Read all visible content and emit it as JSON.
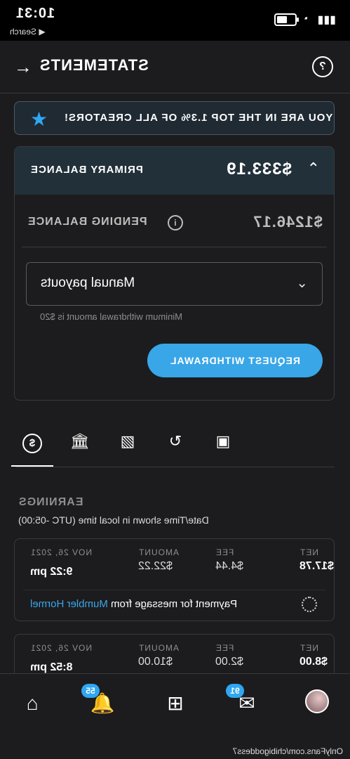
{
  "status_bar": {
    "time": "10:31",
    "back_app": "◀ Search"
  },
  "header": {
    "title": "STATEMENTS",
    "help_symbol": "?"
  },
  "banner": {
    "text": "YOU ARE IN THE TOP 1.3% OF ALL CREATORS!",
    "icon": "star-icon"
  },
  "balance": {
    "primary_label": "PRIMARY BALANCE",
    "primary_amount": "$333.19",
    "pending_label": "PENDING BALANCE",
    "pending_amount": "$1246.17",
    "payout_method": "Manual payouts",
    "min_note": "Minimum withdrawal amount is $20",
    "withdraw_label": "REQUEST WITHDRAWAL"
  },
  "tabs": [
    "earnings-icon",
    "bank-icon",
    "image-icon",
    "refresh-icon",
    "referral-icon"
  ],
  "earnings": {
    "title": "EARNINGS",
    "timezone_note": "Date/Time shown in local time (UTC -05:00)",
    "columns": {
      "date": "",
      "amount": "AMOUNT",
      "fee": "FEE",
      "net": "NET"
    },
    "transactions": [
      {
        "date": "NOV 26, 2021",
        "time": "9:22 pm",
        "amount": "$22.22",
        "fee": "$4.44",
        "net": "$17.78",
        "desc_prefix": "Payment for message from",
        "from": "Mumbler Hormel"
      },
      {
        "date": "NOV 26, 2021",
        "time": "8:52 pm",
        "amount": "$10.00",
        "fee": "$2.00",
        "net": "$8.00",
        "desc_prefix": "",
        "from": ""
      }
    ]
  },
  "bottom_nav": {
    "notifications_badge": "55",
    "messages_badge": "91"
  },
  "footer_url": "OnlyFans.com/chibigoddess7",
  "colors": {
    "accent": "#39a6e8",
    "banner_bg": "#1f2a33",
    "primary_bg": "#22303a"
  }
}
